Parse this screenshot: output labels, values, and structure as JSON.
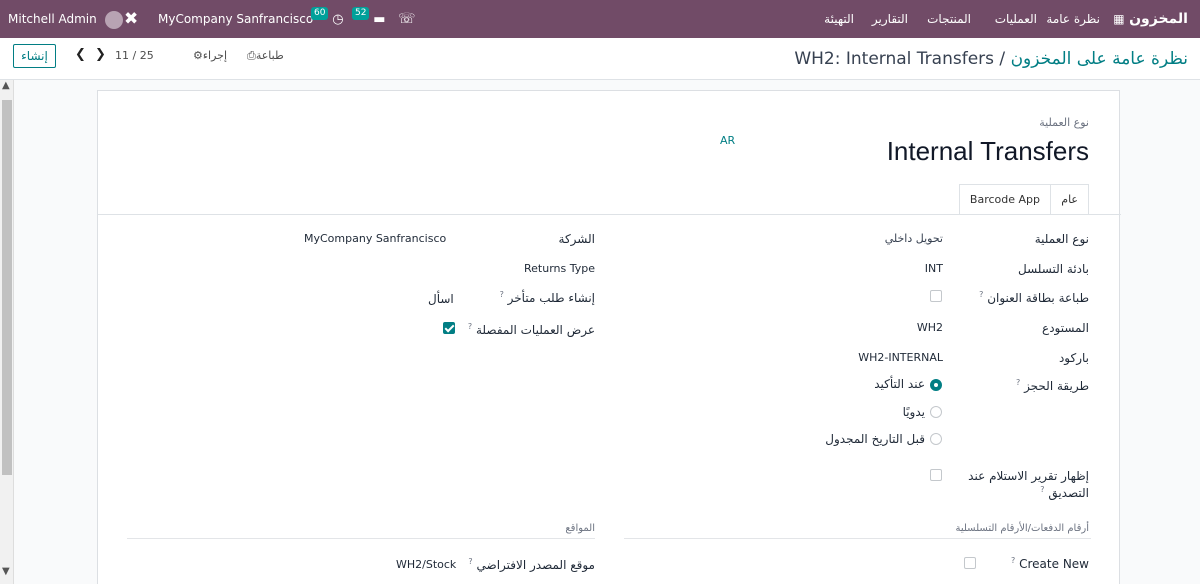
{
  "navbar": {
    "app_name": "المخزون",
    "menu": [
      "نظرة عامة",
      "العمليات",
      "المنتجات",
      "التقارير",
      "التهيئة"
    ],
    "user": "Mitchell Admin",
    "company": "MyCompany Sanfrancisco",
    "activity_count": "60",
    "message_count": "52"
  },
  "control_panel": {
    "breadcrumb_parent": "نظرة عامة على المخزون",
    "breadcrumb_sep": " / ",
    "breadcrumb_current": "WH2: Internal Transfers",
    "print_label": "طباعة",
    "action_label": "إجراء",
    "pager": "11 / 25",
    "create_label": "إنشاء"
  },
  "form": {
    "type_label": "نوع العملية",
    "title": "Internal Transfers",
    "lang": "AR",
    "tabs": [
      "عام",
      "Barcode App"
    ],
    "fields_right": [
      {
        "label": "نوع العملية",
        "value": "تحويل داخلي"
      },
      {
        "label": "بادئة التسلسل",
        "value": "INT"
      },
      {
        "label": "طباعة بطاقة العنوان",
        "tip": "?"
      },
      {
        "label": "المستودع",
        "value": "WH2"
      },
      {
        "label": "باركود",
        "value": "WH2-INTERNAL"
      },
      {
        "label": "طريقة الحجز",
        "tip": "?"
      }
    ],
    "reservation_options": [
      "عند التأكيد",
      "يدويًا",
      "قبل التاريخ المجدول"
    ],
    "receipt_report_label": "إظهار تقرير الاستلام عند",
    "receipt_report_label2": "التصديق",
    "fields_left": [
      {
        "label": "الشركة",
        "value": "MyCompany Sanfrancisco"
      },
      {
        "label": "Returns Type"
      },
      {
        "label": "إنشاء طلب متأخر",
        "value": "اسأل",
        "tip": "?"
      },
      {
        "label": "عرض العمليات المفصلة",
        "tip": "?"
      }
    ],
    "section_lots": "أرقام الدفعات/الأرقام التسلسلية",
    "section_locations": "المواقع",
    "create_new_label": "Create New",
    "default_source_label": "موقع المصدر الافتراضي",
    "default_source_value": "WH2/Stock"
  },
  "colors": {
    "brand": "#714b67",
    "accent": "#017e84"
  }
}
